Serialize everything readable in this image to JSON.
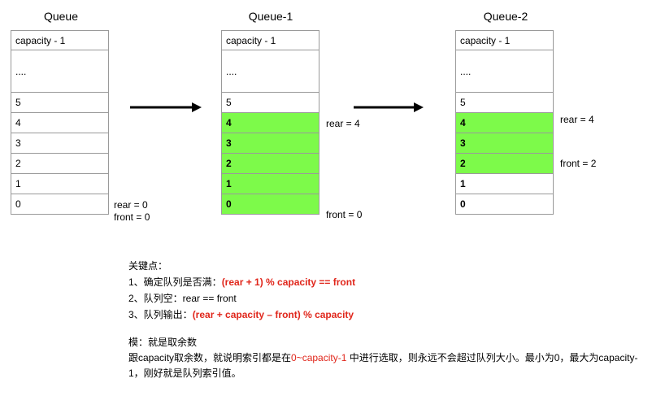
{
  "queues": [
    {
      "title": "Queue",
      "cells": [
        {
          "label": "capacity - 1",
          "filled": false,
          "bold": false,
          "tall": false
        },
        {
          "label": "....",
          "filled": false,
          "bold": false,
          "tall": true
        },
        {
          "label": "5",
          "filled": false,
          "bold": false,
          "tall": false
        },
        {
          "label": "4",
          "filled": false,
          "bold": false,
          "tall": false
        },
        {
          "label": "3",
          "filled": false,
          "bold": false,
          "tall": false
        },
        {
          "label": "2",
          "filled": false,
          "bold": false,
          "tall": false
        },
        {
          "label": "1",
          "filled": false,
          "bold": false,
          "tall": false
        },
        {
          "label": "0",
          "filled": false,
          "bold": false,
          "tall": false
        }
      ],
      "pointers": [
        "rear = 0",
        "front = 0"
      ]
    },
    {
      "title": "Queue-1",
      "cells": [
        {
          "label": "capacity - 1",
          "filled": false,
          "bold": false,
          "tall": false
        },
        {
          "label": "....",
          "filled": false,
          "bold": false,
          "tall": true
        },
        {
          "label": "5",
          "filled": false,
          "bold": false,
          "tall": false
        },
        {
          "label": "4",
          "filled": true,
          "bold": true,
          "tall": false
        },
        {
          "label": "3",
          "filled": true,
          "bold": true,
          "tall": false
        },
        {
          "label": "2",
          "filled": true,
          "bold": true,
          "tall": false
        },
        {
          "label": "1",
          "filled": true,
          "bold": true,
          "tall": false
        },
        {
          "label": "0",
          "filled": true,
          "bold": true,
          "tall": false
        }
      ],
      "pointers": [
        "rear = 4",
        "front = 0"
      ]
    },
    {
      "title": "Queue-2",
      "cells": [
        {
          "label": "capacity - 1",
          "filled": false,
          "bold": false,
          "tall": false
        },
        {
          "label": "....",
          "filled": false,
          "bold": false,
          "tall": true
        },
        {
          "label": "5",
          "filled": false,
          "bold": false,
          "tall": false
        },
        {
          "label": "4",
          "filled": true,
          "bold": true,
          "tall": false
        },
        {
          "label": "3",
          "filled": true,
          "bold": true,
          "tall": false
        },
        {
          "label": "2",
          "filled": true,
          "bold": true,
          "tall": false
        },
        {
          "label": "1",
          "filled": false,
          "bold": true,
          "tall": false
        },
        {
          "label": "0",
          "filled": false,
          "bold": true,
          "tall": false
        }
      ],
      "pointers": [
        "rear = 4",
        "front = 2"
      ]
    }
  ],
  "colors": {
    "fill": "#7dfa4a",
    "accent_red": "#e0261b",
    "border": "#9a9a9a"
  },
  "notes": {
    "heading": "关键点：",
    "line1_prefix": "1、确定队列是否满：",
    "line1_formula": "(rear + 1) % capacity == front",
    "line2": "2、队列空：rear == front",
    "line3_prefix": "3、队列输出：",
    "line3_formula": "(rear + capacity – front) % capacity"
  },
  "explanation": {
    "heading": "模：就是取余数",
    "part1": "跟capacity取余数，就说明索引都是在",
    "range": "0~capacity-1",
    "part2": " 中进行选取，则永远不会超过队列大小。最小为0，最大为capacity-1，刚好就是队列索引值。"
  }
}
